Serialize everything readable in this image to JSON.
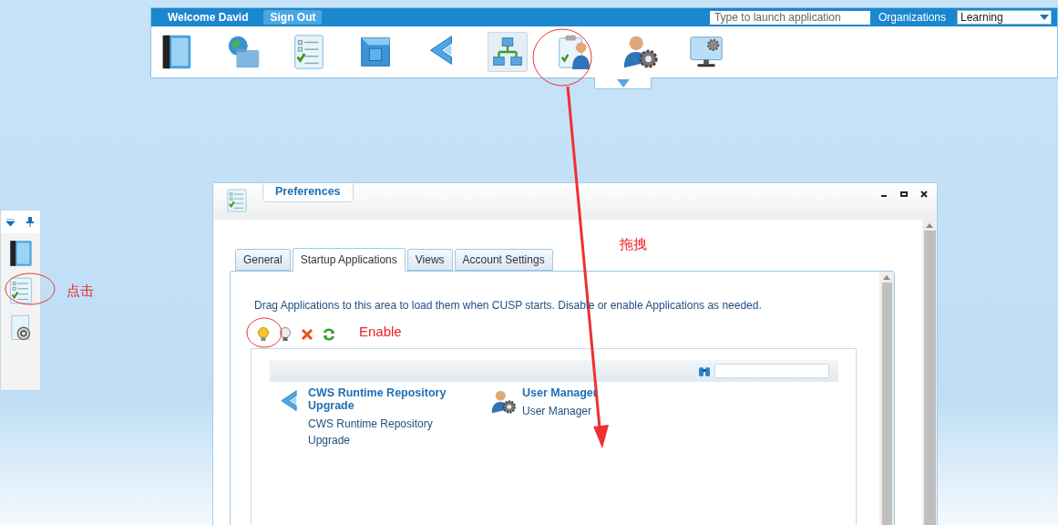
{
  "header": {
    "welcome": "Welcome David",
    "sign_out": "Sign Out",
    "launch_placeholder": "Type to launch application",
    "organizations_label": "Organizations",
    "organization": "Learning"
  },
  "launcher_apps": [
    {
      "kind": "book",
      "selected": false
    },
    {
      "kind": "globe-folder",
      "selected": false
    },
    {
      "kind": "checklist",
      "selected": false
    },
    {
      "kind": "box",
      "selected": false
    },
    {
      "kind": "chevron",
      "selected": false
    },
    {
      "kind": "org-chart",
      "selected": true
    },
    {
      "kind": "clipboard-user",
      "selected": false
    },
    {
      "kind": "user-gear",
      "selected": false
    },
    {
      "kind": "monitor-gear",
      "selected": false
    }
  ],
  "dock": {
    "items": [
      {
        "kind": "book"
      },
      {
        "kind": "checklist"
      },
      {
        "kind": "disc-doc"
      }
    ]
  },
  "window": {
    "title": "Preferences",
    "tabs": [
      {
        "label": "General",
        "selected": false
      },
      {
        "label": "Startup Applications",
        "selected": true
      },
      {
        "label": "Views",
        "selected": false
      },
      {
        "label": "Account Settings",
        "selected": false
      }
    ],
    "description": "Drag Applications to this area to load them when CUSP starts. Disable or enable Applications as needed.",
    "toolbar": [
      {
        "kind": "enable"
      },
      {
        "kind": "disable"
      },
      {
        "kind": "remove"
      },
      {
        "kind": "refresh"
      }
    ],
    "apps": [
      {
        "kind": "chevron",
        "title": "CWS Runtime Repository Upgrade",
        "description": "CWS Runtime Repository Upgrade"
      },
      {
        "kind": "user-gear",
        "title": "User Manager",
        "description": "User Manager"
      }
    ]
  },
  "annotations": {
    "click_label": "点击",
    "drag_label": "拖拽",
    "enable_label": "Enable"
  }
}
